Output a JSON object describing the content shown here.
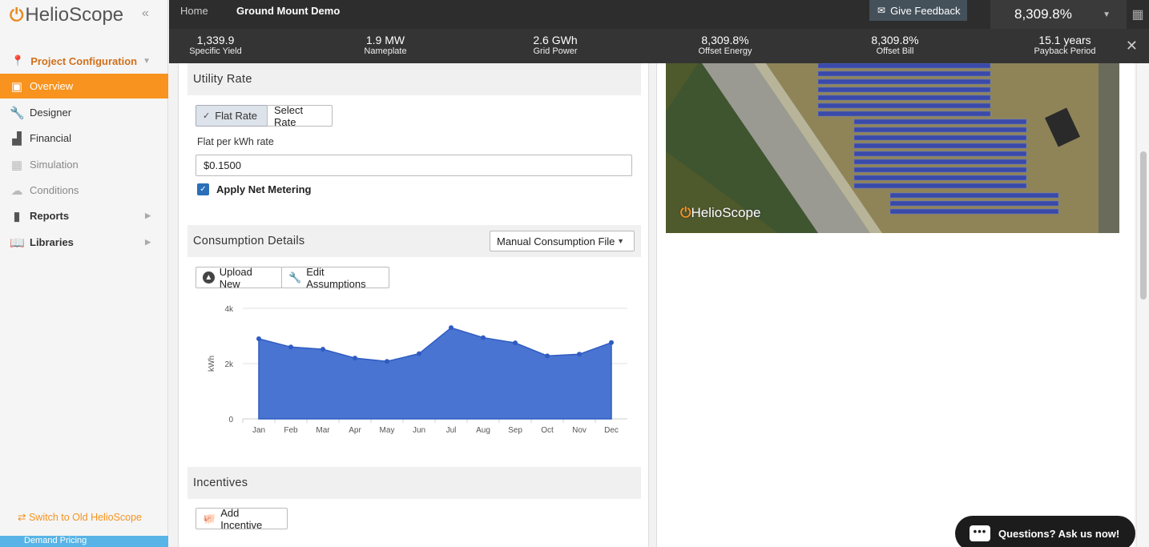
{
  "app": {
    "logo_text": "HelioScope"
  },
  "sidebar": {
    "project_config": "Project Configuration",
    "items": [
      {
        "label": "Overview",
        "icon": "overview-icon"
      },
      {
        "label": "Designer",
        "icon": "wrench-icon"
      },
      {
        "label": "Financial",
        "icon": "bar-chart-icon"
      },
      {
        "label": "Simulation",
        "icon": "calculator-icon"
      },
      {
        "label": "Conditions",
        "icon": "cloud-icon"
      },
      {
        "label": "Reports",
        "icon": "reports-icon"
      },
      {
        "label": "Libraries",
        "icon": "book-icon"
      }
    ],
    "switch_old": "Switch to Old HelioScope",
    "bottom_label": "Demand Pricing"
  },
  "topbar": {
    "home": "Home",
    "project": "Ground Mount Demo",
    "feedback": "Give Feedback",
    "offset_value": "8,309.8%"
  },
  "metrics": [
    {
      "value": "1,339.9",
      "label": "Specific Yield"
    },
    {
      "value": "1.9 MW",
      "label": "Nameplate"
    },
    {
      "value": "2.6 GWh",
      "label": "Grid Power"
    },
    {
      "value": "8,309.8%",
      "label": "Offset Energy"
    },
    {
      "value": "8,309.8%",
      "label": "Offset Bill"
    },
    {
      "value": "15.1 years",
      "label": "Payback Period"
    }
  ],
  "utility": {
    "title": "Utility Rate",
    "flat_rate": "Flat Rate",
    "select_rate": "Select Rate",
    "flat_label": "Flat per kWh rate",
    "rate_value": "$0.1500",
    "net_metering": "Apply Net Metering"
  },
  "consumption": {
    "title": "Consumption Details",
    "select_value": "Manual Consumption File",
    "upload": "Upload New",
    "edit": "Edit Assumptions"
  },
  "incentives": {
    "title": "Incentives",
    "add": "Add Incentive"
  },
  "map": {
    "watermark": "HelioScope"
  },
  "chat": {
    "label": "Questions? Ask us now!"
  },
  "colors": {
    "accent": "#f7931e",
    "area_fill": "#4a74d1",
    "area_line": "#2f5cc2"
  },
  "chart_data": {
    "type": "area",
    "categories": [
      "Jan",
      "Feb",
      "Mar",
      "Apr",
      "May",
      "Jun",
      "Jul",
      "Aug",
      "Sep",
      "Oct",
      "Nov",
      "Dec"
    ],
    "values": [
      2900,
      2600,
      2520,
      2200,
      2080,
      2360,
      3300,
      2940,
      2750,
      2280,
      2340,
      2760
    ],
    "ylabel": "kWh",
    "yticks": [
      "0",
      "2k",
      "4k"
    ],
    "ylim": [
      0,
      4000
    ],
    "grid": true
  }
}
